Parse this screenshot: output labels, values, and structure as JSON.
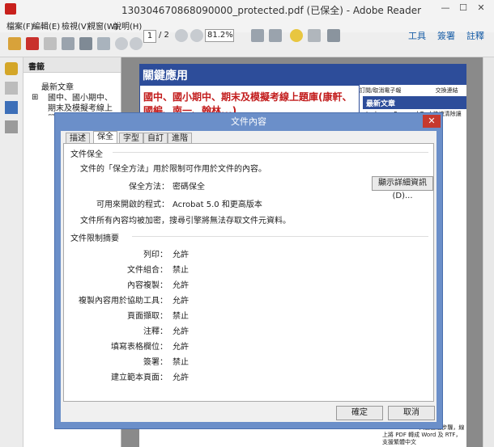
{
  "window": {
    "title": "130304670868090000_protected.pdf (已保全) - Adobe Reader"
  },
  "menubar": {
    "items": [
      "檔案(F)",
      "編輯(E)",
      "檢視(V)",
      "視窗(W)",
      "說明(H)"
    ]
  },
  "toolbar": {
    "page_current": "1",
    "page_total": "/ 2",
    "zoom": "81.2%",
    "tools_label": "工具",
    "sign_label": "簽署",
    "comment_label": "註釋"
  },
  "bookmarks": {
    "title": "書籤",
    "items": [
      "最新文章",
      "國中、國小期中、期末及模擬考線上題庫(康軒、國編、南一、翰林...)"
    ]
  },
  "page": {
    "banner": "關鍵應用",
    "headline": "國中、國小期中、期末及模擬考線上題庫(康軒、國編、南一、翰林...)",
    "subscribe": "訂閱/取消電子報",
    "exchange": "交換連結",
    "side_title": "最新文章",
    "side_text": "Junkware Removal Tool 快速清除讓電腦變慢的廣告軟體(免安裝)",
    "bottom_text": "PDF to Word 只要三個步驟，線上將 PDF 轉成 Word 及 RTF，支援繁體中文"
  },
  "dialog": {
    "title": "文件內容",
    "tabs": [
      "描述",
      "保全",
      "字型",
      "自訂",
      "進階"
    ],
    "active_tab": "保全",
    "security": {
      "section": "文件保全",
      "description": "文件的「保全方法」用於限制可作用於文件的內容。",
      "method_label": "保全方法：",
      "method_value": "密碼保全",
      "details_button": "顯示詳細資訊(D)...",
      "compat_label": "可用來開啟的程式：",
      "compat_value": "Acrobat 5.0 和更高版本",
      "encrypt_note": "文件所有內容均被加密，搜尋引擎將無法存取文件元資料。"
    },
    "restrictions": {
      "section": "文件限制摘要",
      "items": [
        {
          "label": "列印：",
          "value": "允許"
        },
        {
          "label": "文件組合：",
          "value": "禁止"
        },
        {
          "label": "內容複製：",
          "value": "允許"
        },
        {
          "label": "複製內容用於協助工具：",
          "value": "允許"
        },
        {
          "label": "頁面擷取：",
          "value": "禁止"
        },
        {
          "label": "注釋：",
          "value": "允許"
        },
        {
          "label": "填寫表格欄位：",
          "value": "允許"
        },
        {
          "label": "簽署：",
          "value": "禁止"
        },
        {
          "label": "建立範本頁面：",
          "value": "允許"
        }
      ]
    },
    "ok_button": "確定",
    "cancel_button": "取消"
  }
}
